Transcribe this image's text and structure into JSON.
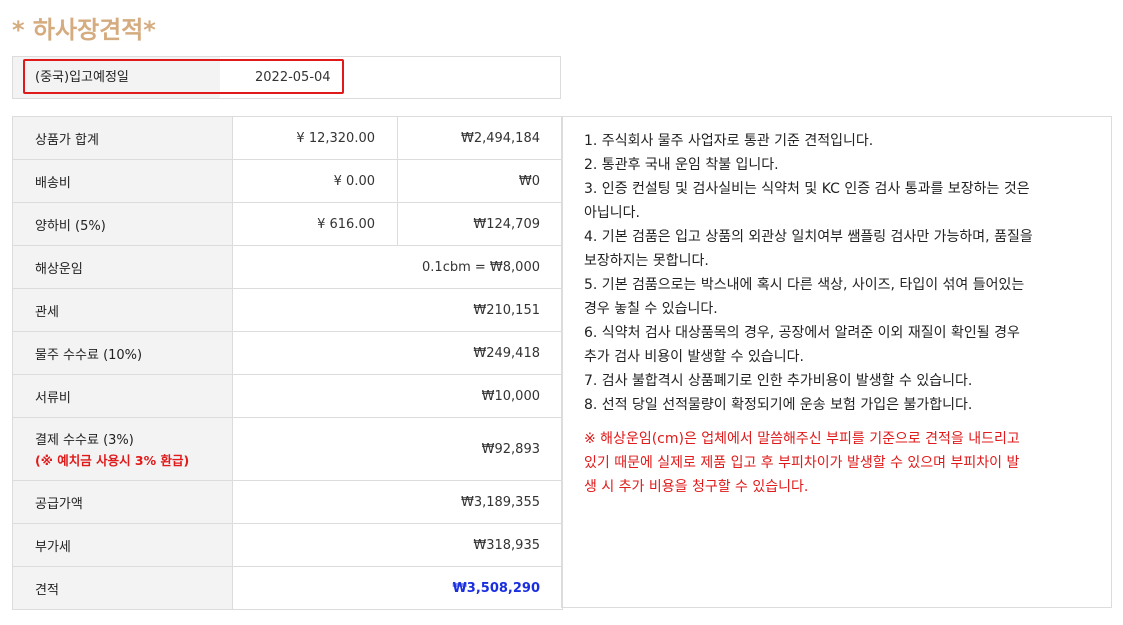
{
  "page": {
    "title": "* 하사장견적*"
  },
  "arrival": {
    "label": "(중국)입고예정일",
    "date": "2022-05-04"
  },
  "costs": {
    "rows": [
      {
        "label": "상품가 합계",
        "cny": "¥ 12,320.00",
        "krw": "₩2,494,184"
      },
      {
        "label": "배송비",
        "cny": "¥ 0.00",
        "krw": "₩0"
      },
      {
        "label": "양하비 (5%)",
        "cny": "¥ 616.00",
        "krw": "₩124,709"
      },
      {
        "label": "해상운임",
        "value": "0.1cbm = ₩8,000"
      },
      {
        "label": "관세",
        "value": "₩210,151"
      },
      {
        "label": "물주 수수료 (10%)",
        "value": "₩249,418"
      },
      {
        "label": "서류비",
        "value": "₩10,000"
      },
      {
        "label": "결제 수수료 (3%)",
        "note": "(※ 예치금 사용시 3% 환급)",
        "value": "₩92,893"
      },
      {
        "label": "공급가액",
        "value": "₩3,189,355"
      },
      {
        "label": "부가세",
        "value": "₩318,935"
      },
      {
        "label": "견적",
        "value": "₩3,508,290"
      }
    ]
  },
  "notes": {
    "lines": [
      "1. 주식회사 물주 사업자로 통관 기준 견적입니다.",
      "2. 통관후 국내 운임 착불 입니다.",
      "3. 인증 컨설팅 및 검사실비는 식약처 및 KC 인증 검사 통과를 보장하는 것은",
      "아닙니다.",
      "4. 기본 검품은 입고 상품의 외관상 일치여부 쌤플링 검사만 가능하며, 품질을",
      "보장하지는 못합니다.",
      "5. 기본 검품으로는 박스내에 혹시 다른 색상, 사이즈, 타입이 섞여 들어있는",
      "경우 놓칠 수 있습니다.",
      "6. 식약처 검사 대상품목의 경우, 공장에서 알려준 이외 재질이 확인될 경우",
      "추가 검사 비용이 발생할 수 있습니다.",
      "7. 검사 불합격시 상품폐기로 인한 추가비용이 발생할 수 있습니다.",
      "8. 선적 당일 선적물량이 확정되기에 운송 보험 가입은 불가합니다."
    ],
    "warning_lines": [
      "※ 해상운임(cm)은 업체에서 말씀해주신 부피를 기준으로 견적을 내드리고",
      "있기 때문에 실제로 제품 입고 후 부피차이가 발생할 수 있으며 부피차이 발",
      "생 시 추가 비용을 청구할 수 있습니다."
    ]
  },
  "colors": {
    "title": "#d4ac7f",
    "highlight_border": "#e01a1a",
    "total": "#1a2fe0",
    "warning": "#e01a1a"
  }
}
